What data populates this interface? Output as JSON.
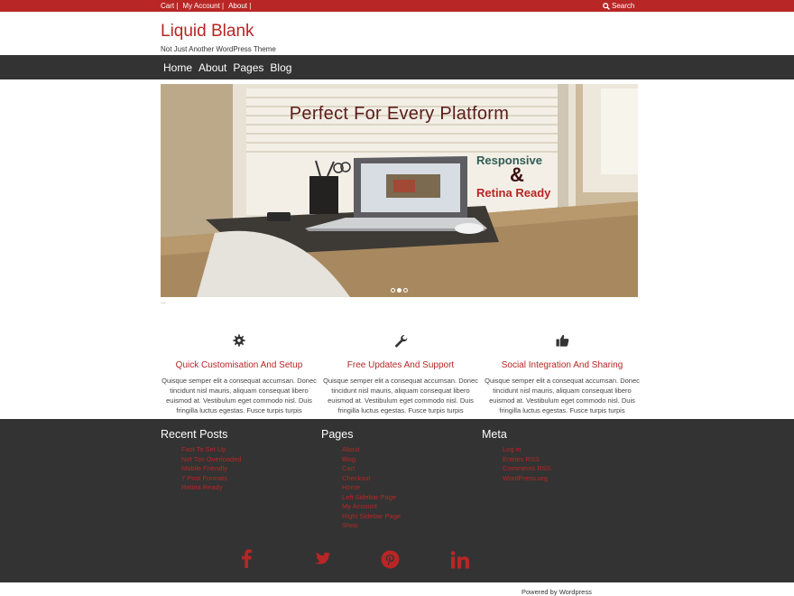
{
  "topbar": {
    "links": [
      "Cart |",
      "My Account |",
      "About |"
    ],
    "search_label": "Search"
  },
  "header": {
    "title": "Liquid Blank",
    "tagline": "Not Just Another WordPress Theme"
  },
  "nav": {
    "items": [
      "Home",
      "About",
      "Pages",
      "Blog"
    ]
  },
  "hero": {
    "title": "Perfect For Every Platform",
    "responsive": "Responsive",
    "ampersand": "&",
    "retina": "Retina Ready",
    "slides_total": 3,
    "active_slide": 2
  },
  "below_slider_text": "...",
  "features": [
    {
      "icon": "gear-icon",
      "title": "Quick Customisation And Setup",
      "text": "Quisque semper elit a consequat accumsan. Donec tincidunt nisl mauris, aliquam consequat libero euismod at. Vestibulum eget commodo nisl. Duis fringilla luctus egestas. Fusce turpis turpis"
    },
    {
      "icon": "wrench-icon",
      "title": "Free Updates And Support",
      "text": "Quisque semper elit a consequat accumsan. Donec tincidunt nisl mauris, aliquam consequat libero euismod at. Vestibulum eget commodo nisl. Duis fringilla luctus egestas. Fusce turpis turpis"
    },
    {
      "icon": "thumbs-up-icon",
      "title": "Social Integration And Sharing",
      "text": "Quisque semper elit a consequat accumsan. Donec tincidunt nisl mauris, aliquam consequat libero euismod at. Vestibulum eget commodo nisl. Duis fringilla luctus egestas. Fusce turpis turpis"
    }
  ],
  "footer": {
    "recent_posts": {
      "title": "Recent Posts",
      "items": [
        "Fast To Set Up",
        "Not Too Overloaded",
        "Mobile Friendly",
        "7 Post Formats",
        "Retina Ready"
      ]
    },
    "pages": {
      "title": "Pages",
      "items": [
        "About",
        "Blog",
        "Cart",
        "Checkout",
        "Home",
        "Left Sidebar Page",
        "My Account",
        "Right Sidebar Page",
        "Shop"
      ]
    },
    "meta": {
      "title": "Meta",
      "items": [
        "Log in",
        "Entries RSS",
        "Comments RSS",
        "WordPress.org"
      ]
    },
    "social": [
      "facebook-icon",
      "twitter-icon",
      "pinterest-icon",
      "linkedin-icon"
    ]
  },
  "powered_by": "Powered by Wordpress",
  "colors": {
    "accent": "#b82625",
    "dark": "#333333"
  }
}
